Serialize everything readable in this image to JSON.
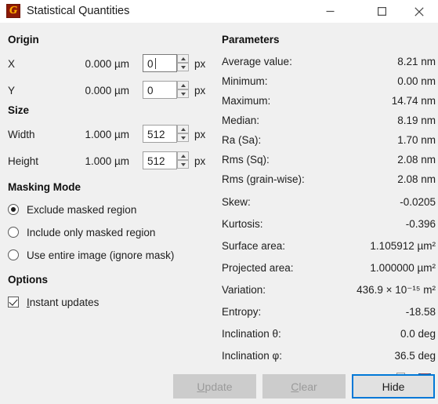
{
  "window": {
    "title": "Statistical Quantities",
    "app_icon": "gwyddion-icon",
    "icon_glyph": "G",
    "minimize_label": "Minimize",
    "maximize_label": "Maximize",
    "close_label": "Close"
  },
  "origin": {
    "heading": "Origin",
    "rows": [
      {
        "label": "X",
        "metric": "0.000 µm",
        "value": "0",
        "unit": "px",
        "focused": true
      },
      {
        "label": "Y",
        "metric": "0.000 µm",
        "value": "0",
        "unit": "px",
        "focused": false
      }
    ]
  },
  "size": {
    "heading": "Size",
    "rows": [
      {
        "label": "Width",
        "metric": "1.000 µm",
        "value": "512",
        "unit": "px",
        "focused": false
      },
      {
        "label": "Height",
        "metric": "1.000 µm",
        "value": "512",
        "unit": "px",
        "focused": false
      }
    ]
  },
  "masking": {
    "heading": "Masking Mode",
    "options": [
      {
        "label": "Exclude masked region",
        "selected": true
      },
      {
        "label": "Include only masked region",
        "selected": false
      },
      {
        "label": "Use entire image (ignore mask)",
        "selected": false
      }
    ]
  },
  "options": {
    "heading": "Options",
    "instant_updates": {
      "label": "Instant updates",
      "accel": "I",
      "rest": "nstant updates",
      "checked": true
    }
  },
  "parameters": {
    "heading": "Parameters",
    "rows": [
      {
        "label": "Average value:",
        "value": "8.21 nm"
      },
      {
        "label": "Minimum:",
        "value": "0.00 nm"
      },
      {
        "label": "Maximum:",
        "value": "14.74 nm"
      },
      {
        "label": "Median:",
        "value": "8.19 nm"
      },
      {
        "label": "Ra (Sa):",
        "value": "1.70 nm"
      },
      {
        "label": "Rms (Sq):",
        "value": "2.08 nm"
      },
      {
        "label": "Rms (grain-wise):",
        "value": "2.08 nm"
      },
      {
        "label": "Skew:",
        "value": "-0.0205"
      },
      {
        "label": "Kurtosis:",
        "value": "-0.396"
      },
      {
        "label": "Surface area:",
        "value": "1.105912 µm²"
      },
      {
        "label": "Projected area:",
        "value": "1.000000 µm²"
      },
      {
        "label": "Variation:",
        "value": "436.9 × 10⁻¹⁵ m²"
      },
      {
        "label": "Entropy:",
        "value": "-18.58"
      },
      {
        "label": "Inclination θ:",
        "value": "0.0 deg"
      },
      {
        "label": "Inclination φ:",
        "value": "36.5 deg"
      }
    ]
  },
  "tools": {
    "copy_label": "copy-icon",
    "save_label": "save-icon"
  },
  "buttons": {
    "update": {
      "label": "Update",
      "accel": "U",
      "rest": "pdate",
      "enabled": false
    },
    "clear": {
      "label": "Clear",
      "accel": "C",
      "rest": "lear",
      "enabled": false
    },
    "hide": {
      "label": "Hide",
      "enabled": true,
      "focused": true
    }
  },
  "colors": {
    "accent": "#0078d7",
    "window_bg": "#f0f0f0",
    "titlebar_bg": "#ffffff",
    "disabled_button_bg": "#cccccc"
  }
}
